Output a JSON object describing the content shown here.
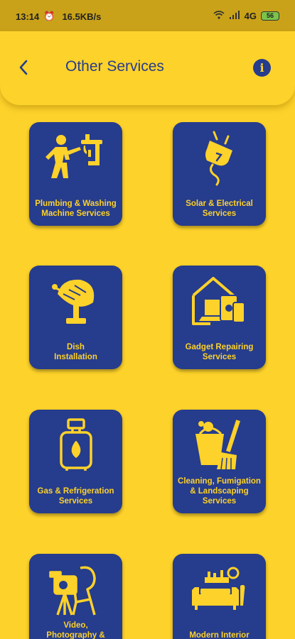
{
  "status_bar": {
    "time": "13:14",
    "speed": "16.5KB/s",
    "network": "4G",
    "battery": "56",
    "icons": [
      "alarm-icon",
      "wifi-icon",
      "signal-icon",
      "battery-icon"
    ]
  },
  "header": {
    "title": "Other Services",
    "back_icon": "chevron-left-icon",
    "info_label": "i"
  },
  "services": [
    {
      "label": "Plumbing & Washing\nMachine Services",
      "icon": "plumber-icon"
    },
    {
      "label": "Solar & Electrical\nServices",
      "icon": "electric-plug-icon"
    },
    {
      "label": "Dish\nInstallation",
      "icon": "satellite-dish-icon"
    },
    {
      "label": "Gadget Repairing\nServices",
      "icon": "gadgets-icon"
    },
    {
      "label": "Gas & Refrigeration\nServices",
      "icon": "gas-cylinder-icon"
    },
    {
      "label": "Cleaning, Fumigation\n& Landscaping\nServices",
      "icon": "cleaning-bucket-icon"
    },
    {
      "label": "Video,\nPhotography &\nGraphics Services",
      "icon": "camera-operator-icon"
    },
    {
      "label": "Modern Interior\nDesign",
      "icon": "interior-sofa-icon"
    }
  ],
  "colors": {
    "background": "#FDD22A",
    "card": "#263C8C",
    "accent_text": "#FDD22A"
  }
}
